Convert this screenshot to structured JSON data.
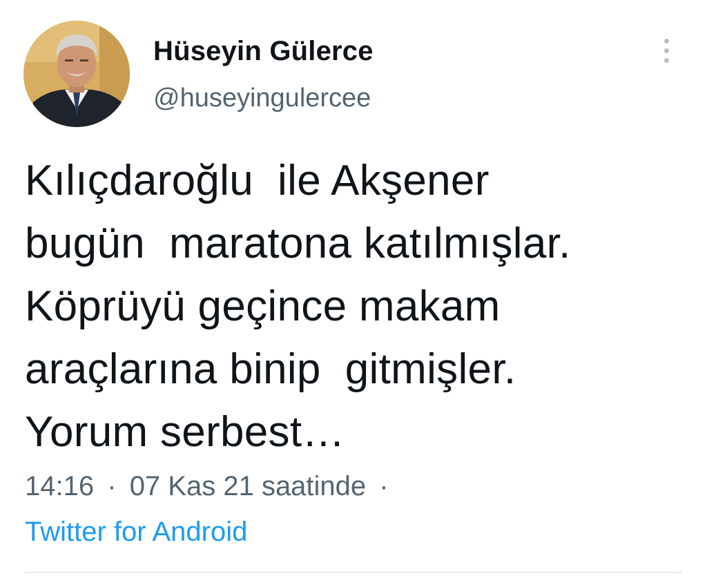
{
  "author": {
    "display_name": "Hüseyin Gülerce",
    "handle": "@huseyingulercee",
    "avatar_icon": "profile-photo"
  },
  "tweet": {
    "text": "Kılıçdaroğlu  ile Akşener\nbugün  maratona katılmışlar.\nKöprüyü geçince makam\naraçlarına binip  gitmişler.\nYorum serbest…",
    "time": "14:16",
    "date": "07 Kas 21 saatinde",
    "separator": "·",
    "source": "Twitter for Android"
  },
  "colors": {
    "text": "#0f1419",
    "secondary": "#536471",
    "link": "#1d9bf0",
    "divider": "#cfd9de"
  },
  "icons": {
    "more": "more-vertical-icon"
  }
}
